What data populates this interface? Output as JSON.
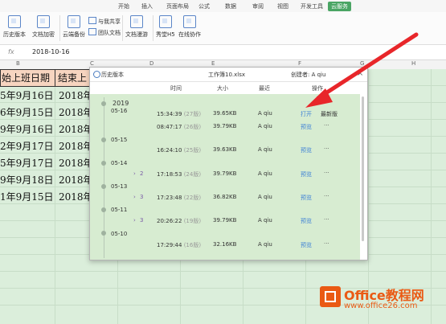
{
  "tabs": [
    "开始",
    "插入",
    "页面布局",
    "公式",
    "数据",
    "审阅",
    "视图",
    "开发工具",
    "云服务"
  ],
  "ribbon": {
    "history": "历史版本",
    "doc_encrypt": "文档加密",
    "cloud_backup": "云端备份",
    "shared_with_me": "与我共享",
    "team_docs": "团队文档",
    "doc_roaming": "文档漫游",
    "show_h5": "秀堂H5",
    "online_collab": "在线协作"
  },
  "formula_bar": {
    "fx": "fx",
    "value": "2018-10-16"
  },
  "columns": [
    "B",
    "C",
    "D",
    "E",
    "F",
    "G",
    "H"
  ],
  "sheet": {
    "header_b": "始上班日期",
    "header_c": "结束上",
    "rows_b": [
      "5年9月16日",
      "6年9月15日",
      "9年9月16日",
      "2年9月17日",
      "5年9月17日",
      "9年9月18日",
      "1年9月15日"
    ],
    "rows_c": [
      "2018年1",
      "2018年1",
      "2018年1",
      "2018年1",
      "2018年1",
      "2018年1",
      "2018年1"
    ]
  },
  "dialog": {
    "title": "历史版本",
    "file": "工作簿10.xlsx",
    "creator": "创建者: A qiu",
    "close": "×",
    "headers": {
      "time": "时间",
      "size": "大小",
      "latest": "最近",
      "action": "操作"
    },
    "year": "2019",
    "dates": [
      "05-16",
      "05-15",
      "05-14",
      "05-13",
      "05-11",
      "05-10"
    ],
    "rows": [
      {
        "time": "15:34:39",
        "ver": "(27版)",
        "size": "39.65KB",
        "user": "A qiu",
        "action": "打开",
        "extra": "最新版"
      },
      {
        "time": "08:47:17",
        "ver": "(26版)",
        "size": "39.79KB",
        "user": "A qiu",
        "action": "预览",
        "extra": "···"
      },
      {
        "time": "16:24:10",
        "ver": "(25版)",
        "size": "39.63KB",
        "user": "A qiu",
        "action": "预览",
        "extra": "···"
      },
      {
        "time": "17:18:53",
        "ver": "(24版)",
        "size": "39.79KB",
        "user": "A qiu",
        "action": "预览",
        "extra": "···",
        "expand": "2"
      },
      {
        "time": "17:23:48",
        "ver": "(22版)",
        "size": "36.82KB",
        "user": "A qiu",
        "action": "预览",
        "extra": "···",
        "expand": "3"
      },
      {
        "time": "20:26:22",
        "ver": "(19版)",
        "size": "39.79KB",
        "user": "A qiu",
        "action": "预览",
        "extra": "···",
        "expand": "3"
      },
      {
        "time": "17:29:44",
        "ver": "(16版)",
        "size": "32.16KB",
        "user": "A qiu",
        "action": "预览",
        "extra": "···"
      }
    ]
  },
  "watermark": {
    "brand": "Office教程网",
    "url": "www.office26.com"
  },
  "colors": {
    "accent": "#4aa564",
    "arrow": "#e8262a",
    "link": "#3f82d6",
    "brand": "#ea5a14"
  }
}
